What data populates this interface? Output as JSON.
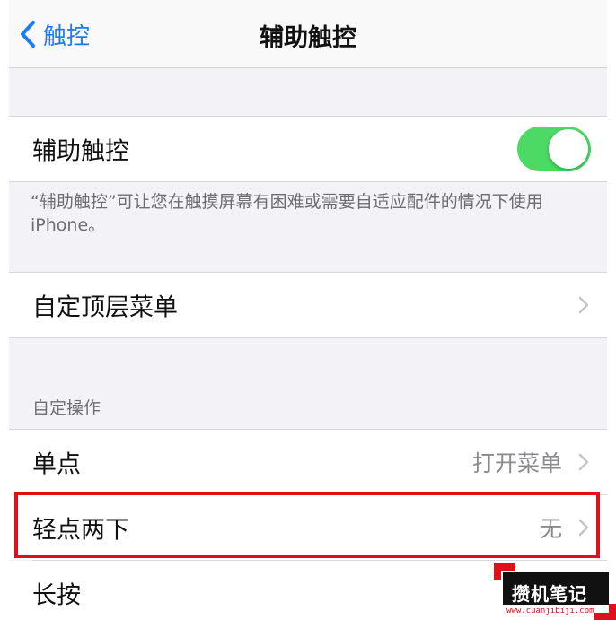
{
  "nav": {
    "back_label": "触控",
    "title": "辅助触控"
  },
  "assistive_touch": {
    "label": "辅助触控",
    "toggle_on": true,
    "toggle_color": "#4cd964",
    "footer": "“辅助触控”可让您在触摸屏幕有困难或需要自适应配件的情况下使用iPhone。"
  },
  "custom_top_menu": {
    "label": "自定顶层菜单"
  },
  "custom_actions": {
    "header": "自定操作",
    "rows": [
      {
        "label": "单点",
        "value": "打开菜单"
      },
      {
        "label": "轻点两下",
        "value": "无"
      },
      {
        "label": "长按",
        "value": ""
      }
    ]
  },
  "highlight_color": "#e0101a",
  "watermark": {
    "text": "攒机笔记",
    "url": "www.cuanjibiji.com"
  }
}
